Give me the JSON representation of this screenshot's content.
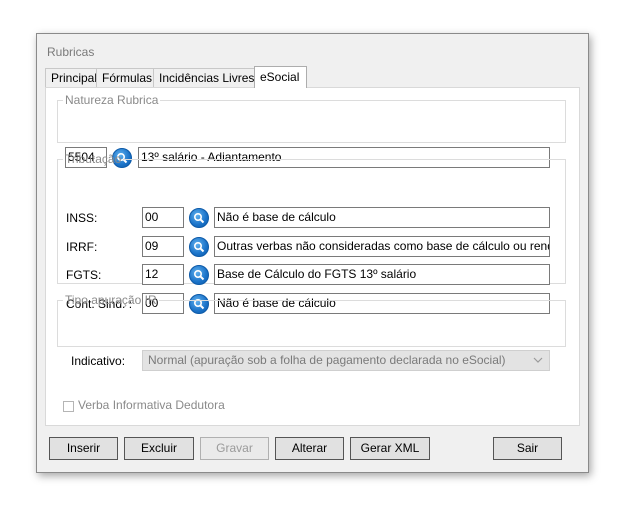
{
  "window": {
    "title": "Rubricas"
  },
  "tabs": [
    {
      "label": "Principal"
    },
    {
      "label": "Fórmulas"
    },
    {
      "label": "Incidências Livres"
    },
    {
      "label": "eSocial"
    }
  ],
  "natureza": {
    "legend": "Natureza Rubrica",
    "code": "5504",
    "description": "13º salário - Adiantamento"
  },
  "tributacao": {
    "legend": "Tributação",
    "rows": [
      {
        "label": "INSS:",
        "code": "00",
        "description": "Não é base de cálculo"
      },
      {
        "label": "IRRF:",
        "code": "09",
        "description": "Outras verbas não consideradas como base de cálculo ou rendime"
      },
      {
        "label": "FGTS:",
        "code": "12",
        "description": "Base de Cálculo do FGTS 13º salário"
      },
      {
        "label": "Cont. Sind. :",
        "code": "00",
        "description": "Não é base de cálculo"
      }
    ]
  },
  "apuracao": {
    "legend": "Tipo apuração IR",
    "label": "Indicativo:",
    "selected": "Normal (apuração sob a folha de pagamento declarada no eSocial)"
  },
  "verba": {
    "label": "Verba Informativa Dedutora",
    "checked": false
  },
  "buttons": {
    "insert": "Inserir",
    "delete": "Excluir",
    "save": "Gravar",
    "edit": "Alterar",
    "xml": "Gerar XML",
    "exit": "Sair"
  },
  "icons": {
    "search": "search-icon",
    "dropdown": "chevron-down-icon"
  },
  "colors": {
    "search_button": "#1a72c8"
  }
}
